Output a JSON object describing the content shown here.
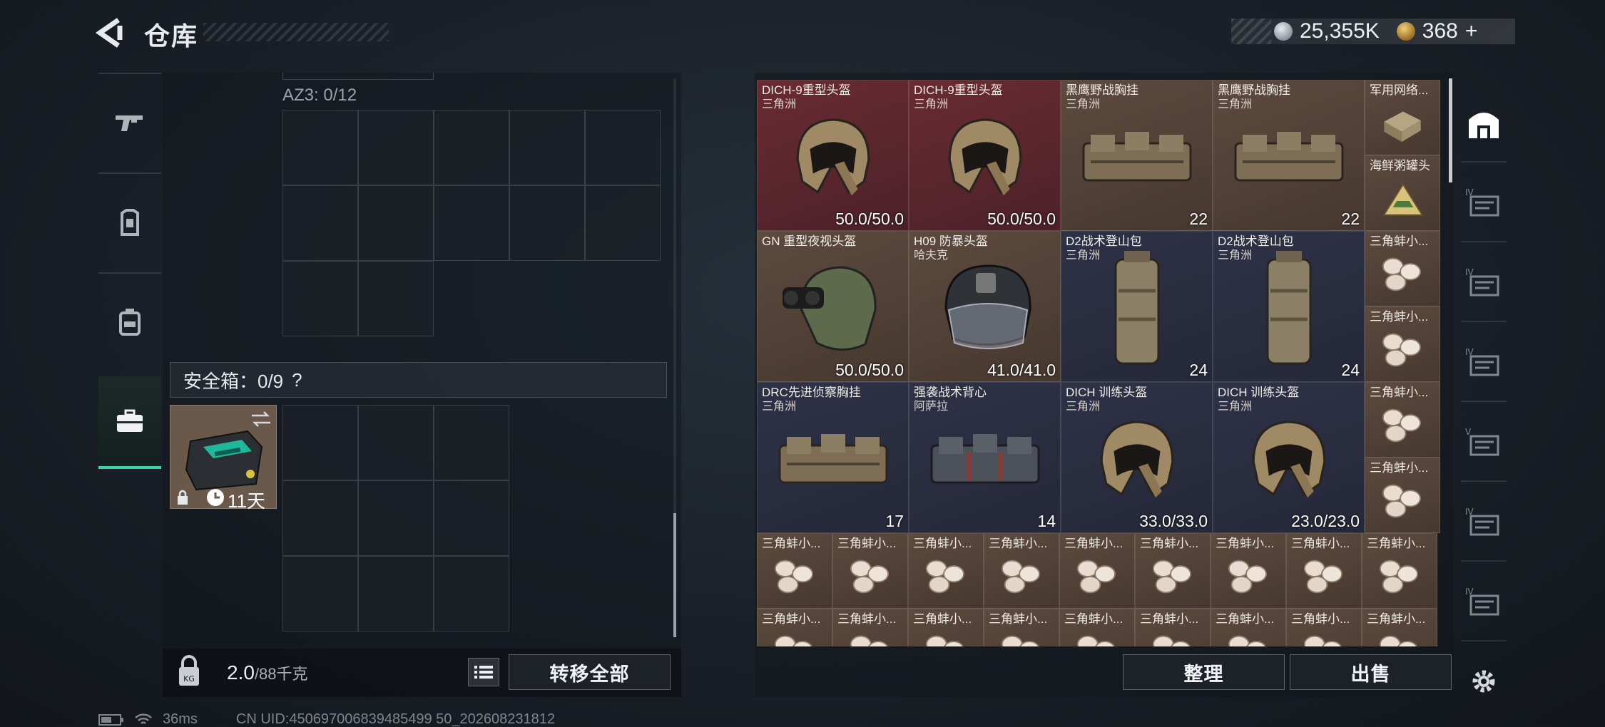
{
  "header": {
    "title": "仓库",
    "silver_amount": "25,355K",
    "gold_amount": "368",
    "plus_label": "+"
  },
  "left_nav": [
    "weapon-icon",
    "armor-icon",
    "backpack-icon",
    "toolbox-icon"
  ],
  "container": {
    "az3_label": "AZ3: 0/12",
    "safe_box_label": "安全箱：0/9",
    "safe_box_help": "?",
    "safe_item_timer": "11天",
    "weight_value": "2.0",
    "weight_unit": "/88千克",
    "transfer_all": "转移全部"
  },
  "items": [
    {
      "name": "DICH-9重型头盔",
      "sub": "三角洲",
      "value": "50.0/50.0",
      "color": "red",
      "icon": "helmet-icon"
    },
    {
      "name": "DICH-9重型头盔",
      "sub": "三角洲",
      "value": "50.0/50.0",
      "color": "red",
      "icon": "helmet-icon"
    },
    {
      "name": "黑鹰野战胸挂",
      "sub": "三角洲",
      "value": "22",
      "color": "brown",
      "icon": "chest-rig-icon"
    },
    {
      "name": "黑鹰野战胸挂",
      "sub": "三角洲",
      "value": "22",
      "color": "brown",
      "icon": "chest-rig-icon"
    },
    {
      "name": "军用网络...",
      "sub": "",
      "value": "",
      "color": "brown",
      "icon": "network-box-icon"
    },
    {
      "name": "海鲜粥罐头",
      "sub": "",
      "value": "",
      "color": "brown",
      "icon": "food-can-icon"
    },
    {
      "name": "GN 重型夜视头盔",
      "sub": "",
      "value": "50.0/50.0",
      "color": "brown",
      "icon": "nvg-helmet-icon"
    },
    {
      "name": "H09 防暴头盔",
      "sub": "哈夫克",
      "value": "41.0/41.0",
      "color": "brown",
      "icon": "riot-helmet-icon"
    },
    {
      "name": "D2战术登山包",
      "sub": "三角洲",
      "value": "24",
      "color": "blue",
      "icon": "backpack-icon"
    },
    {
      "name": "D2战术登山包",
      "sub": "三角洲",
      "value": "24",
      "color": "blue",
      "icon": "backpack-icon"
    },
    {
      "name": "DRC先进侦察胸挂",
      "sub": "三角洲",
      "value": "17",
      "color": "blue",
      "icon": "chest-rig-icon"
    },
    {
      "name": "强袭战术背心",
      "sub": "阿萨拉",
      "value": "14",
      "color": "blue",
      "icon": "vest-icon"
    },
    {
      "name": "DICH 训练头盔",
      "sub": "三角洲",
      "value": "33.0/33.0",
      "color": "blue",
      "icon": "helmet-icon"
    },
    {
      "name": "DICH 训练头盔",
      "sub": "三角洲",
      "value": "23.0/23.0",
      "color": "blue",
      "icon": "helmet-icon"
    }
  ],
  "shell_item_label": "三角蚌小...",
  "actions": {
    "organize": "整理",
    "sell": "出售"
  },
  "right_nav": [
    "warehouse-icon",
    "storage-iv-1-icon",
    "storage-iv-2-icon",
    "storage-iv-add-icon",
    "storage-v-icon",
    "storage-iv-3-icon",
    "storage-iv-4-icon",
    "settings-icon"
  ],
  "status_bar": {
    "ping": "36ms",
    "uid": "CN UID:450697006839485499 50_202608231812"
  }
}
